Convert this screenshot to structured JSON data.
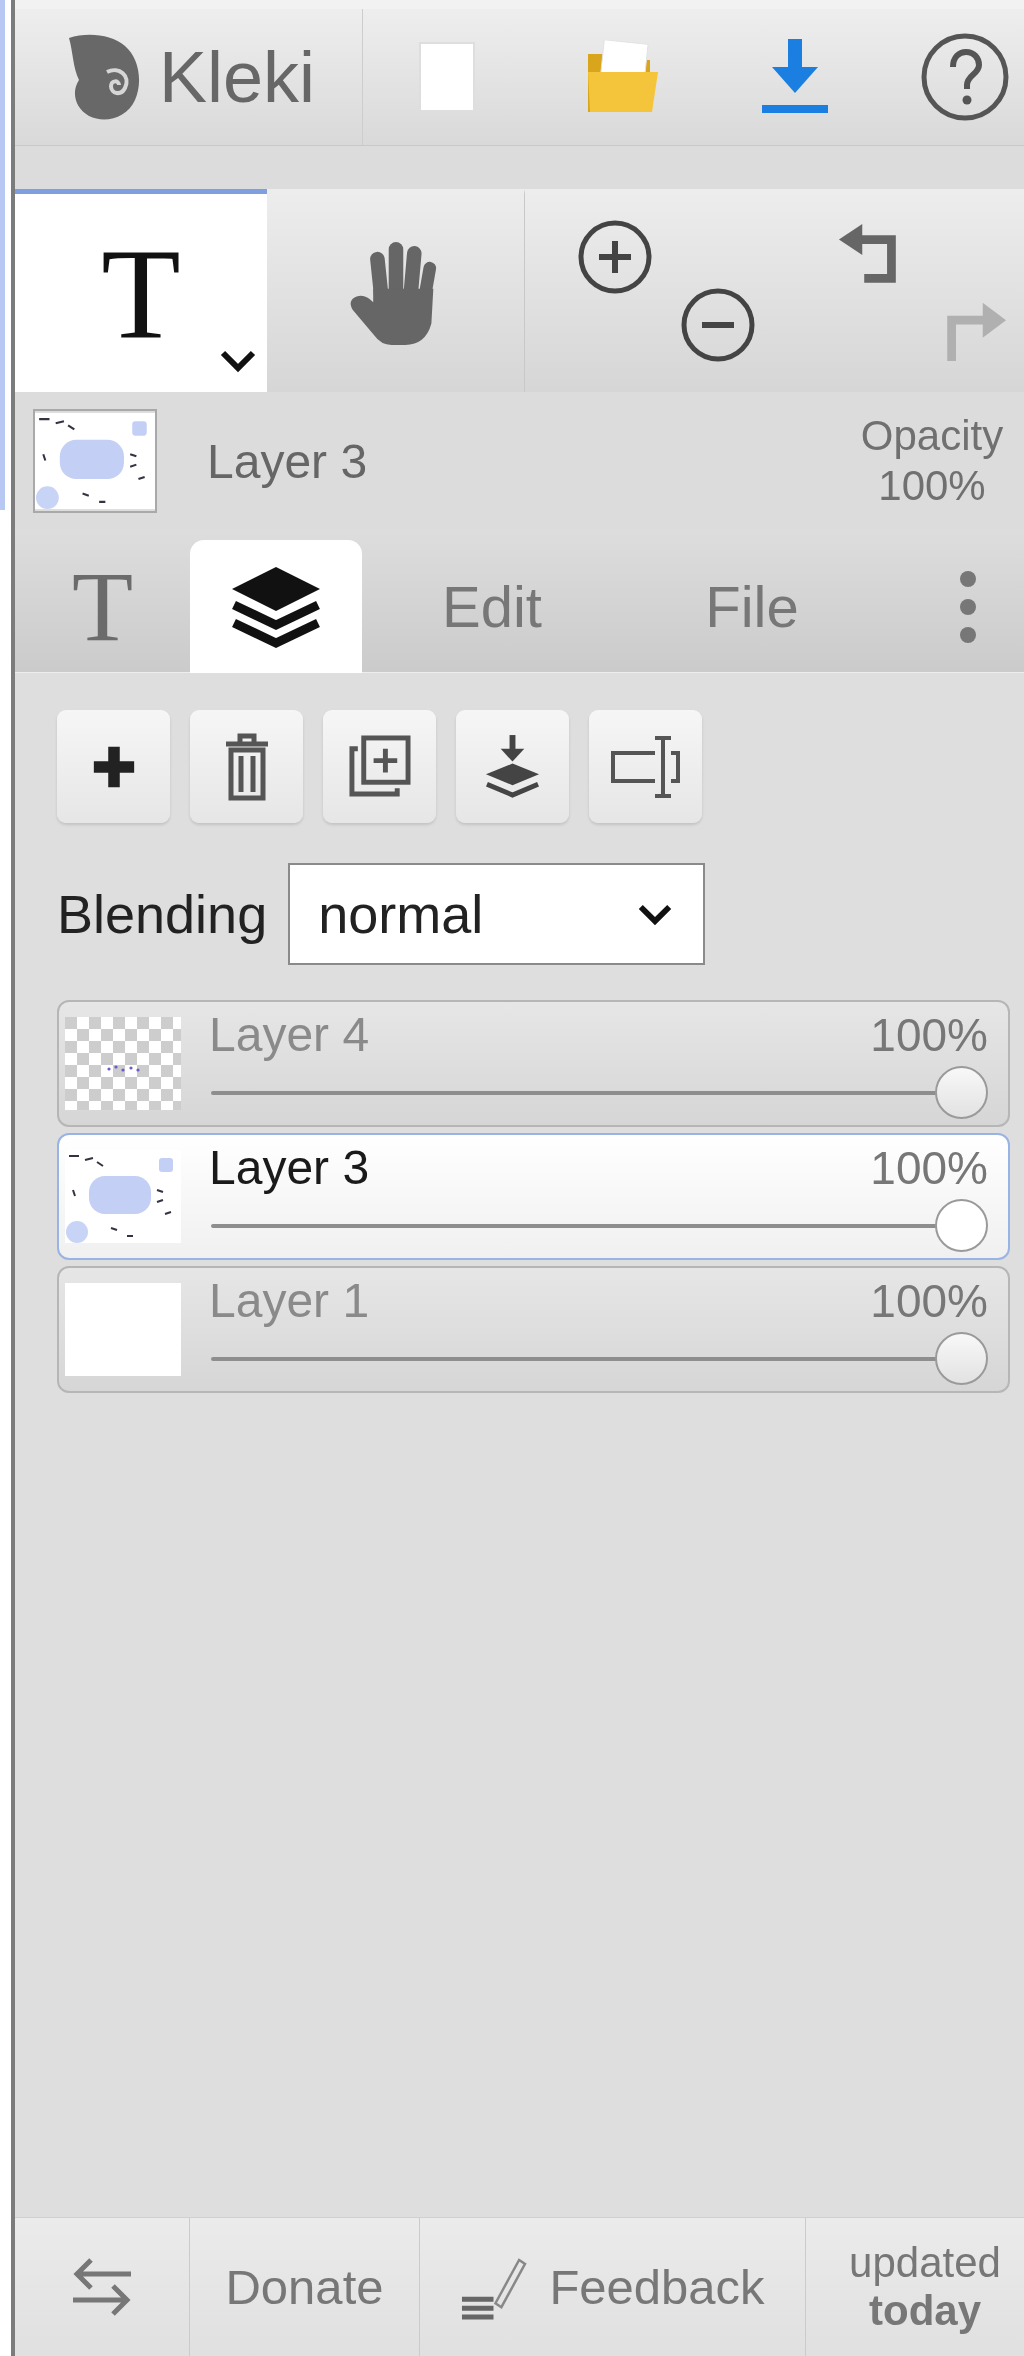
{
  "header": {
    "logo": "Kleki"
  },
  "tools": [
    {
      "kind": "text",
      "label": "T",
      "selected": true
    },
    {
      "kind": "hand",
      "selected": false
    }
  ],
  "history": [
    {
      "kind": "undo",
      "disabled": false
    },
    {
      "kind": "redo",
      "disabled": true
    }
  ],
  "current_layer": {
    "name": "Layer 3",
    "opacity_label": "Opacity",
    "opacity": "100%"
  },
  "tabs": [
    {
      "kind": "glyph",
      "label": "T",
      "selected": false
    },
    {
      "kind": "layers",
      "selected": true
    },
    {
      "kind": "text",
      "label": "Edit",
      "selected": false
    },
    {
      "kind": "text",
      "label": "File",
      "selected": false
    },
    {
      "kind": "more",
      "selected": false
    }
  ],
  "blending": {
    "label": "Blending",
    "value": "normal"
  },
  "layers": [
    {
      "name": "Layer 4",
      "opacity": "100%",
      "level": 1,
      "selected": false,
      "kind": "checker"
    },
    {
      "name": "Layer 3",
      "opacity": "100%",
      "level": 1,
      "selected": true,
      "kind": "sketch"
    },
    {
      "name": "Layer 1",
      "opacity": "100%",
      "level": 1,
      "selected": false,
      "kind": "blank"
    }
  ],
  "footer": [
    {
      "kind": "swap"
    },
    {
      "kind": "link",
      "label": "Donate"
    },
    {
      "kind": "feedback",
      "label": "Feedback"
    },
    {
      "kind": "updated",
      "label": "updated",
      "note": "today"
    }
  ]
}
